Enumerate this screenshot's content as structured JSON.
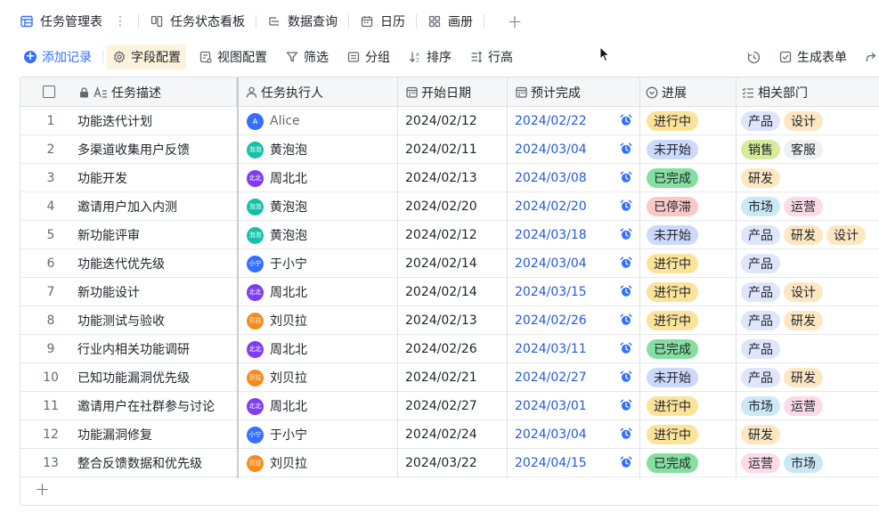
{
  "views": [
    {
      "label": "任务管理表",
      "icon": "grid-view-icon"
    },
    {
      "label": "任务状态看板",
      "icon": "kanban-icon"
    },
    {
      "label": "数据查询",
      "icon": "query-icon"
    },
    {
      "label": "日历",
      "icon": "calendar-icon"
    },
    {
      "label": "画册",
      "icon": "gallery-icon"
    }
  ],
  "toolbar": {
    "add_record": "添加记录",
    "field_config": "字段配置",
    "view_config": "视图配置",
    "filter": "筛选",
    "group": "分组",
    "sort": "排序",
    "row_height": "行高",
    "generate_form": "生成表单"
  },
  "columns": {
    "desc": "任务描述",
    "assignee": "任务执行人",
    "start": "开始日期",
    "due": "预计完成",
    "progress": "进展",
    "dept": "相关部门"
  },
  "colors": {
    "accent": "#3370ff",
    "status": {
      "进行中": "#fbe39a",
      "未开始": "#cdd9fb",
      "已完成": "#86dfa0",
      "已停滞": "#f8c9c6"
    },
    "tags": {
      "产品": "#dfe6fb",
      "设计": "#fde7c3",
      "销售": "#d4ec9c",
      "客服": "#eff0f1",
      "研发": "#fde7c3",
      "市场": "#cbe9f4",
      "运营": "#fbdbe8"
    },
    "avatars": {
      "Alice": "#3370ff",
      "黄泡泡": "#14c0a8",
      "周北北": "#7f3bf5",
      "于小宁": "#3370ff",
      "刘贝拉": "#f28c1c"
    }
  },
  "rows": [
    {
      "num": "1",
      "desc": "功能迭代计划",
      "assignee": "Alice",
      "avatar_text": "A",
      "start": "2024/02/12",
      "due": "2024/02/22",
      "status": "进行中",
      "depts": [
        "产品",
        "设计"
      ]
    },
    {
      "num": "2",
      "desc": "多渠道收集用户反馈",
      "assignee": "黄泡泡",
      "avatar_text": "泡泡",
      "start": "2024/02/11",
      "due": "2024/03/04",
      "status": "未开始",
      "depts": [
        "销售",
        "客服"
      ]
    },
    {
      "num": "3",
      "desc": "功能开发",
      "assignee": "周北北",
      "avatar_text": "北北",
      "start": "2024/02/13",
      "due": "2024/03/08",
      "status": "已完成",
      "depts": [
        "研发"
      ]
    },
    {
      "num": "4",
      "desc": "邀请用户加入内测",
      "assignee": "黄泡泡",
      "avatar_text": "泡泡",
      "start": "2024/02/20",
      "due": "2024/02/20",
      "status": "已停滞",
      "depts": [
        "市场",
        "运营"
      ]
    },
    {
      "num": "5",
      "desc": "新功能评审",
      "assignee": "黄泡泡",
      "avatar_text": "泡泡",
      "start": "2024/02/12",
      "due": "2024/03/18",
      "status": "未开始",
      "depts": [
        "产品",
        "研发",
        "设计"
      ]
    },
    {
      "num": "6",
      "desc": "功能迭代优先级",
      "assignee": "于小宁",
      "avatar_text": "小宁",
      "start": "2024/02/14",
      "due": "2024/03/04",
      "status": "进行中",
      "depts": [
        "产品"
      ]
    },
    {
      "num": "7",
      "desc": "新功能设计",
      "assignee": "周北北",
      "avatar_text": "北北",
      "start": "2024/02/14",
      "due": "2024/03/15",
      "status": "进行中",
      "depts": [
        "产品",
        "设计"
      ]
    },
    {
      "num": "8",
      "desc": "功能测试与验收",
      "assignee": "刘贝拉",
      "avatar_text": "贝拉",
      "start": "2024/02/13",
      "due": "2024/02/26",
      "status": "进行中",
      "depts": [
        "产品",
        "研发"
      ]
    },
    {
      "num": "9",
      "desc": "行业内相关功能调研",
      "assignee": "周北北",
      "avatar_text": "北北",
      "start": "2024/02/26",
      "due": "2024/03/11",
      "status": "已完成",
      "depts": [
        "产品"
      ]
    },
    {
      "num": "10",
      "desc": "已知功能漏洞优先级",
      "assignee": "刘贝拉",
      "avatar_text": "贝拉",
      "start": "2024/02/21",
      "due": "2024/02/27",
      "status": "未开始",
      "depts": [
        "产品",
        "研发"
      ]
    },
    {
      "num": "11",
      "desc": "邀请用户在社群参与讨论",
      "assignee": "周北北",
      "avatar_text": "北北",
      "start": "2024/02/27",
      "due": "2024/03/01",
      "status": "进行中",
      "depts": [
        "市场",
        "运营"
      ]
    },
    {
      "num": "12",
      "desc": "功能漏洞修复",
      "assignee": "于小宁",
      "avatar_text": "小宁",
      "start": "2024/02/24",
      "due": "2024/03/04",
      "status": "进行中",
      "depts": [
        "研发"
      ]
    },
    {
      "num": "13",
      "desc": "整合反馈数据和优先级",
      "assignee": "刘贝拉",
      "avatar_text": "贝拉",
      "start": "2024/03/22",
      "due": "2024/04/15",
      "status": "已完成",
      "depts": [
        "运营",
        "市场"
      ]
    }
  ]
}
